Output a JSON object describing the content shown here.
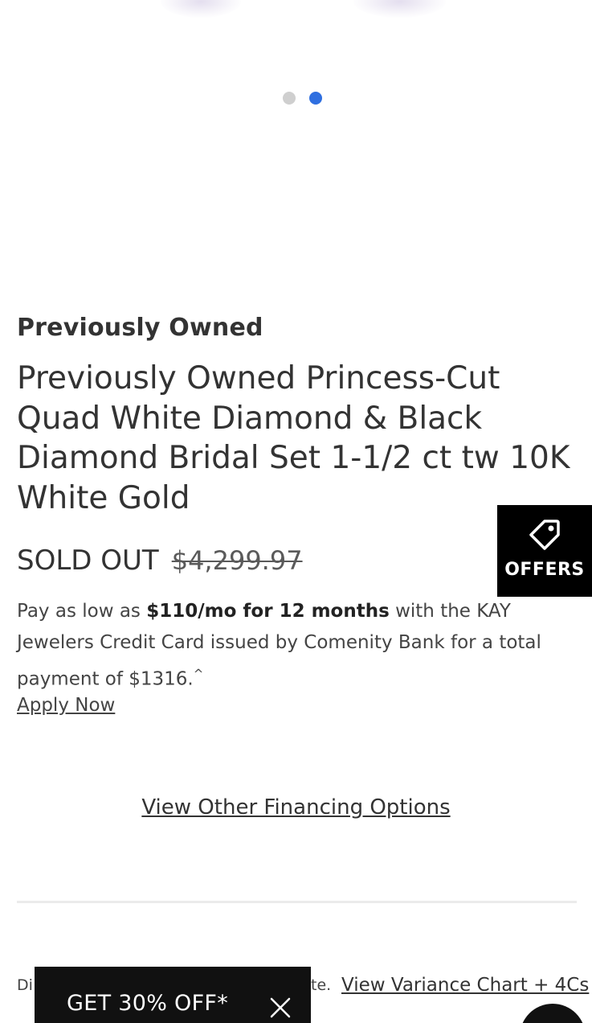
{
  "carousel": {
    "slide_count": 2,
    "active_index": 1
  },
  "product": {
    "eyebrow": "Previously Owned",
    "title": "Previously Owned Princess-Cut Quad White Diamond & Black Diamond Bridal Set 1-1/2 ct tw 10K White Gold",
    "status": "SOLD OUT",
    "original_price": "$4,299.97"
  },
  "offers_button": {
    "label": "OFFERS",
    "icon": "tag-icon"
  },
  "financing": {
    "intro": "Pay as low as ",
    "monthly": "$110/mo for 12 months",
    "middle": " with the KAY Jewelers Credit Card issued by Comenity Bank for a total payment of $1316.",
    "footnote_mark": "^",
    "apply_label": "Apply Now",
    "other_options_label": "View Other Financing Options"
  },
  "disclaimer": {
    "visible_start": "Di",
    "visible_end": "te.",
    "link_label": "View Variance Chart + 4Cs"
  },
  "promo_banner": {
    "text": "GET 30% OFF*",
    "close_icon": "close-icon"
  },
  "colors": {
    "active_dot": "#2f6fe0",
    "inactive_dot": "#cfcfcf",
    "offers_bg": "#000000",
    "promo_bg": "#111111"
  }
}
